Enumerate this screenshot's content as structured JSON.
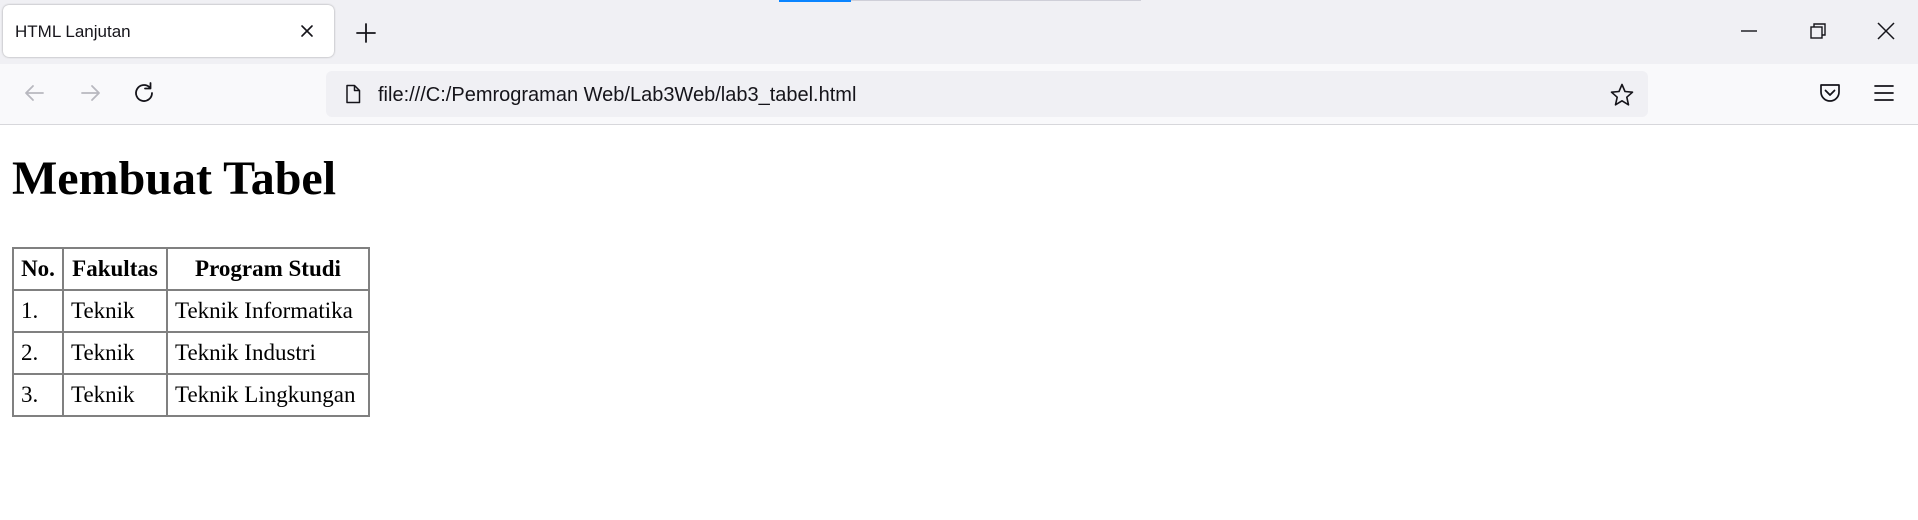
{
  "browser": {
    "tab": {
      "title": "HTML Lanjutan",
      "close_icon": "close-icon"
    },
    "new_tab_icon": "plus-icon",
    "window_controls": [
      "minimize-icon",
      "restore-icon",
      "close-icon"
    ],
    "nav": {
      "back_icon": "arrow-left-icon",
      "forward_icon": "arrow-right-icon",
      "reload_icon": "reload-icon",
      "url": "file:///C:/Pemrograman Web/Lab3Web/lab3_tabel.html",
      "page_icon": "document-icon",
      "bookmark_icon": "star-icon",
      "pocket_icon": "pocket-icon",
      "menu_icon": "hamburger-icon"
    }
  },
  "page": {
    "heading": "Membuat Tabel",
    "table": {
      "headers": [
        "No.",
        "Fakultas",
        "Program Studi"
      ],
      "rows": [
        [
          "1.",
          "Teknik",
          "Teknik Informatika"
        ],
        [
          "2.",
          "Teknik",
          "Teknik Industri"
        ],
        [
          "3.",
          "Teknik",
          "Teknik Lingkungan"
        ]
      ]
    }
  },
  "colors": {
    "tabstrip_bg": "#f0f0f4",
    "navbar_bg": "#f9f9fb",
    "urlbar_bg": "#f0f0f4",
    "accent": "#0a84ff",
    "table_border": "#808080"
  }
}
